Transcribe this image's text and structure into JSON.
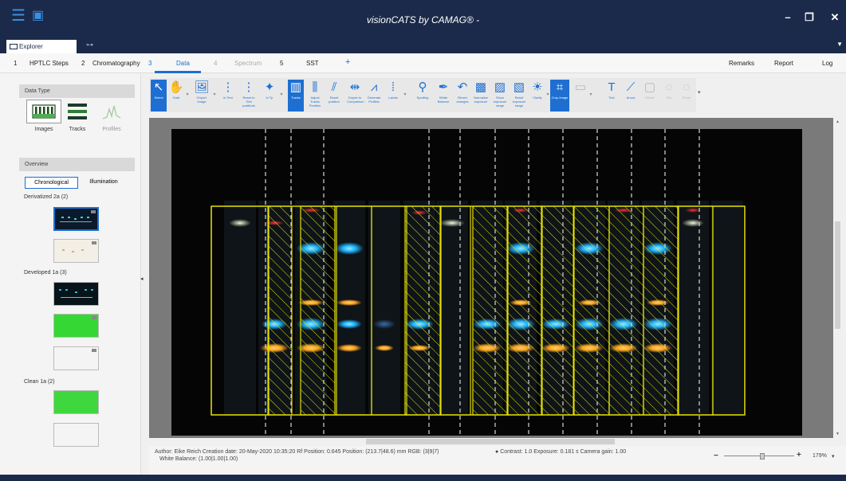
{
  "app": {
    "title": "visionCATS by CAMAG® -",
    "explorer_tab": "Explorer",
    "chain_icon": "link-icon"
  },
  "steps": [
    {
      "num": "1",
      "label": "HPTLC Steps"
    },
    {
      "num": "2",
      "label": "Chromatography"
    },
    {
      "num": "3",
      "label": "Data"
    },
    {
      "num": "4",
      "label": "Spectrum"
    },
    {
      "num": "5",
      "label": "SST"
    }
  ],
  "right_tabs": {
    "remarks": "Remarks",
    "report": "Report",
    "log": "Log"
  },
  "left": {
    "data_type_header": "Data Type",
    "types": {
      "images": "Images",
      "tracks": "Tracks",
      "profiles": "Profiles"
    },
    "overview_header": "Overview",
    "overview_tabs": {
      "chronological": "Chronological",
      "illumination": "Illumination"
    },
    "groups": {
      "derivatized": "Derivatized 2a (2)",
      "developed": "Developed 1a (3)",
      "clean": "Clean 1a (2)"
    }
  },
  "toolbar": {
    "select": "Select",
    "grab": "Grab",
    "export_image": "Export Image",
    "in_text": "in Text",
    "reset_to_text": "Reset to Text positions",
    "in_tp": "in Tp",
    "tracks": "Tracks",
    "adjust_tracks": "Adjust Tracks Position",
    "reset_position": "Reset position",
    "export_comparison": "Export to Comparison",
    "generate_profiles": "Generate Profiles",
    "labels": "Labels",
    "spotting": "Spotting",
    "white_balance": "White Balance",
    "revert_changes": "Revert changes",
    "normalize_exposure": "Normalize exposure",
    "show_exposure_range": "Show exposure range",
    "reset_exposure_range": "Reset exposure range",
    "clarify": "Clarify",
    "crop_image": "Crop image",
    "text": "Text",
    "arrow": "Arrow",
    "rotate": "Rotate",
    "flip": "Flip",
    "reset": "Reset"
  },
  "status": {
    "line1": "Author: Eike Reich   Creation date: 20-May-2020 10:35:20   Rf Position: 0.645   Position: (213.7|48.6) mm   RGB: (3|9|7)",
    "line2": "White Balance: (1.00|1.00|1.00)",
    "contrast": "Contrast: 1.0   Exposure: 0.181 s   Camera gain: 1.00",
    "zoom": "179%"
  },
  "colors": {
    "titlebar": "#1b2a4a",
    "accent": "#1e6fd1",
    "track_border": "#e3e000",
    "band_blue": "#1fb4ff",
    "band_orange": "#f7a020",
    "band_green": "#4dff4d"
  }
}
